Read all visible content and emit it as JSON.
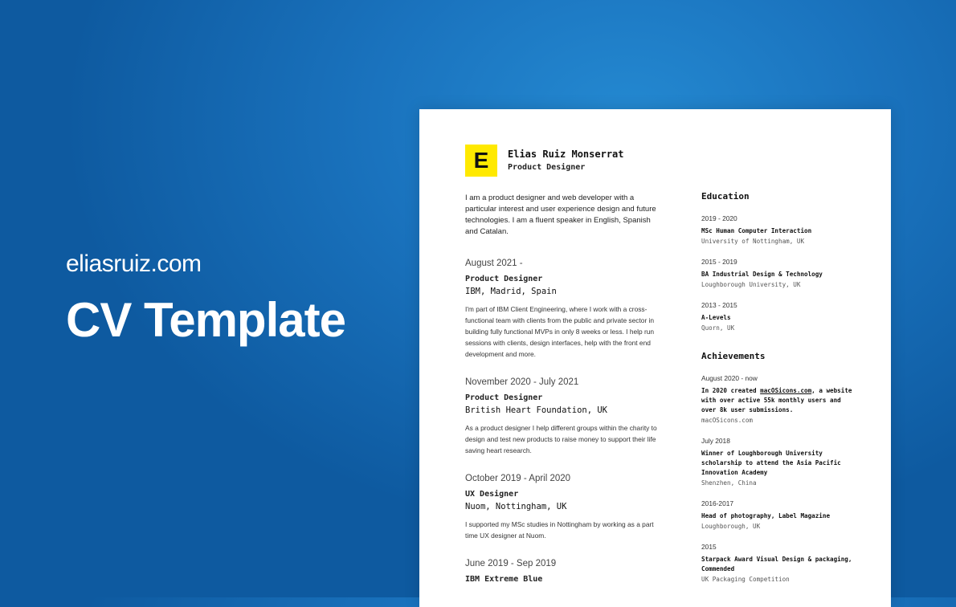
{
  "site": "eliasruiz.com",
  "hero_title": "CV Template",
  "colors": {
    "accent": "#ffe900",
    "background": "#1a73be"
  },
  "cv": {
    "logo_letter": "E",
    "name": "Elias Ruiz Monserrat",
    "role": "Product Designer",
    "intro": "I am a product designer and web developer with a particular interest and user experience design and future technologies. I am a fluent speaker in English, Spanish and Catalan.",
    "jobs": [
      {
        "date": "August 2021 -",
        "title": "Product Designer",
        "company": "IBM, Madrid, Spain",
        "desc": "I'm part of IBM Client Engineering, where I work with a cross-functional team with clients from the public and private sector in building fully functional MVPs in only 8 weeks or less. I help run sessions with clients, design interfaces, help with the front end development and more."
      },
      {
        "date": "November 2020 - July 2021",
        "title": "Product Designer",
        "company": "British Heart Foundation, UK",
        "desc": "As a product designer I help different groups within the charity to design and test new products to raise money to support their life saving heart research."
      },
      {
        "date": "October 2019 - April 2020",
        "title": "UX Designer",
        "company": "Nuom, Nottingham, UK",
        "desc": "I supported my MSc studies in Nottingham by working as a part time UX designer at Nuom."
      },
      {
        "date": "June 2019 - Sep 2019",
        "title": "IBM Extreme Blue",
        "company": "",
        "desc": ""
      }
    ],
    "education_title": "Education",
    "education": [
      {
        "years": "2019 - 2020",
        "title": "MSc Human Computer Interaction",
        "place": "University of Nottingham, UK"
      },
      {
        "years": "2015 - 2019",
        "title": "BA Industrial Design & Technology",
        "place": "Loughborough University, UK"
      },
      {
        "years": "2013 - 2015",
        "title": "A-Levels",
        "place": "Quorn, UK"
      }
    ],
    "achievements_title": "Achievements",
    "achievements": [
      {
        "date": "August 2020 - now",
        "pre": "In 2020 created ",
        "link": "macOSicons.com",
        "post": ", a website with over active 55k monthly users and over 8k user submissions.",
        "place": "macOSicons.com"
      },
      {
        "date": "July 2018",
        "pre": "Winner of Loughborough University scholarship to attend the Asia Pacific Innovation Academy",
        "link": "",
        "post": "",
        "place": "Shenzhen, China"
      },
      {
        "date": "2016-2017",
        "pre": "Head of photography, Label Magazine",
        "link": "",
        "post": "",
        "place": "Loughborough, UK"
      },
      {
        "date": "2015",
        "pre": "Starpack Award Visual Design & packaging, Commended",
        "link": "",
        "post": "",
        "place": "UK Packaging Competition"
      }
    ]
  }
}
